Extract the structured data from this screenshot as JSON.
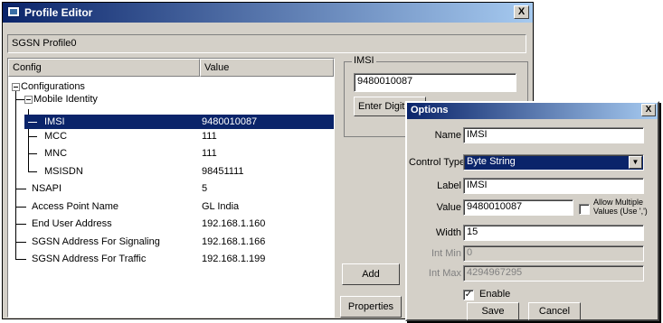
{
  "window": {
    "title": "Profile Editor",
    "close_label": "X"
  },
  "profile_name": "SGSN Profile0",
  "tree": {
    "col_config": "Config",
    "col_value": "Value",
    "root": "Configurations",
    "group": "Mobile Identity",
    "rows": [
      {
        "name": "IMSI",
        "value": "9480010087"
      },
      {
        "name": "MCC",
        "value": "111"
      },
      {
        "name": "MNC",
        "value": "111"
      },
      {
        "name": "MSISDN",
        "value": "98451111"
      },
      {
        "name": "NSAPI",
        "value": "5"
      },
      {
        "name": "Access Point Name",
        "value": "GL India"
      },
      {
        "name": "End User Address",
        "value": "192.168.1.160"
      },
      {
        "name": "SGSN Address For Signaling",
        "value": "192.168.1.166"
      },
      {
        "name": "SGSN Address For Traffic",
        "value": "192.168.1.199"
      }
    ]
  },
  "imsi_group": {
    "legend": "IMSI",
    "value": "9480010087",
    "hint": "Enter Digit"
  },
  "buttons": {
    "add": "Add",
    "properties": "Properties"
  },
  "options": {
    "title": "Options",
    "close_label": "X",
    "name_label": "Name",
    "name_value": "IMSI",
    "control_type_label": "Control Type",
    "control_type_value": "Byte String",
    "label_label": "Label",
    "label_value": "IMSI",
    "value_label": "Value",
    "value_value": "9480010087",
    "allow_multiple_label1": "Allow Multiple",
    "allow_multiple_label2": "Values (Use ',')",
    "width_label": "Width",
    "width_value": "15",
    "int_min_label": "Int Min",
    "int_min_value": "0",
    "int_max_label": "Int Max",
    "int_max_value": "4294967295",
    "enable_label": "Enable",
    "enable_check": "✓",
    "save": "Save",
    "cancel": "Cancel"
  }
}
